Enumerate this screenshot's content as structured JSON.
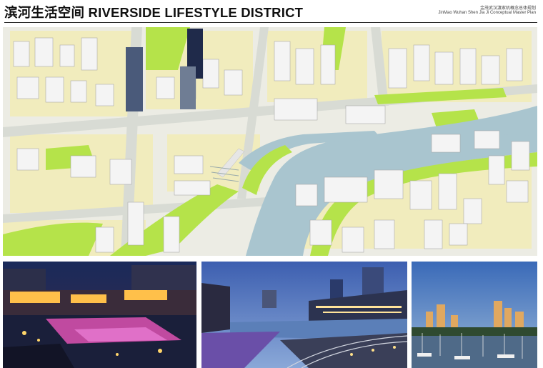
{
  "header": {
    "title": "滨河生活空间 RIVERSIDE LIFESTYLE DISTRICT",
    "subtitle_cn": "金茂武汉渡家机概念总体规划",
    "subtitle_en": "JinMao Wuhan Shen Jia Ji Conceptual Master Plan"
  },
  "masterplan": {
    "image": "riverside-masterplan-aerial"
  },
  "photos": [
    {
      "image": "night-waterfront-festival-market"
    },
    {
      "image": "dusk-promenade-river-cityscape"
    },
    {
      "image": "marina-skyline-sunset"
    }
  ],
  "colors": {
    "river": "#a9c5cf",
    "green": "#b5e34a",
    "land": "#f1ecbd",
    "road": "#d9dbd5",
    "building": "#f2f2f2"
  }
}
